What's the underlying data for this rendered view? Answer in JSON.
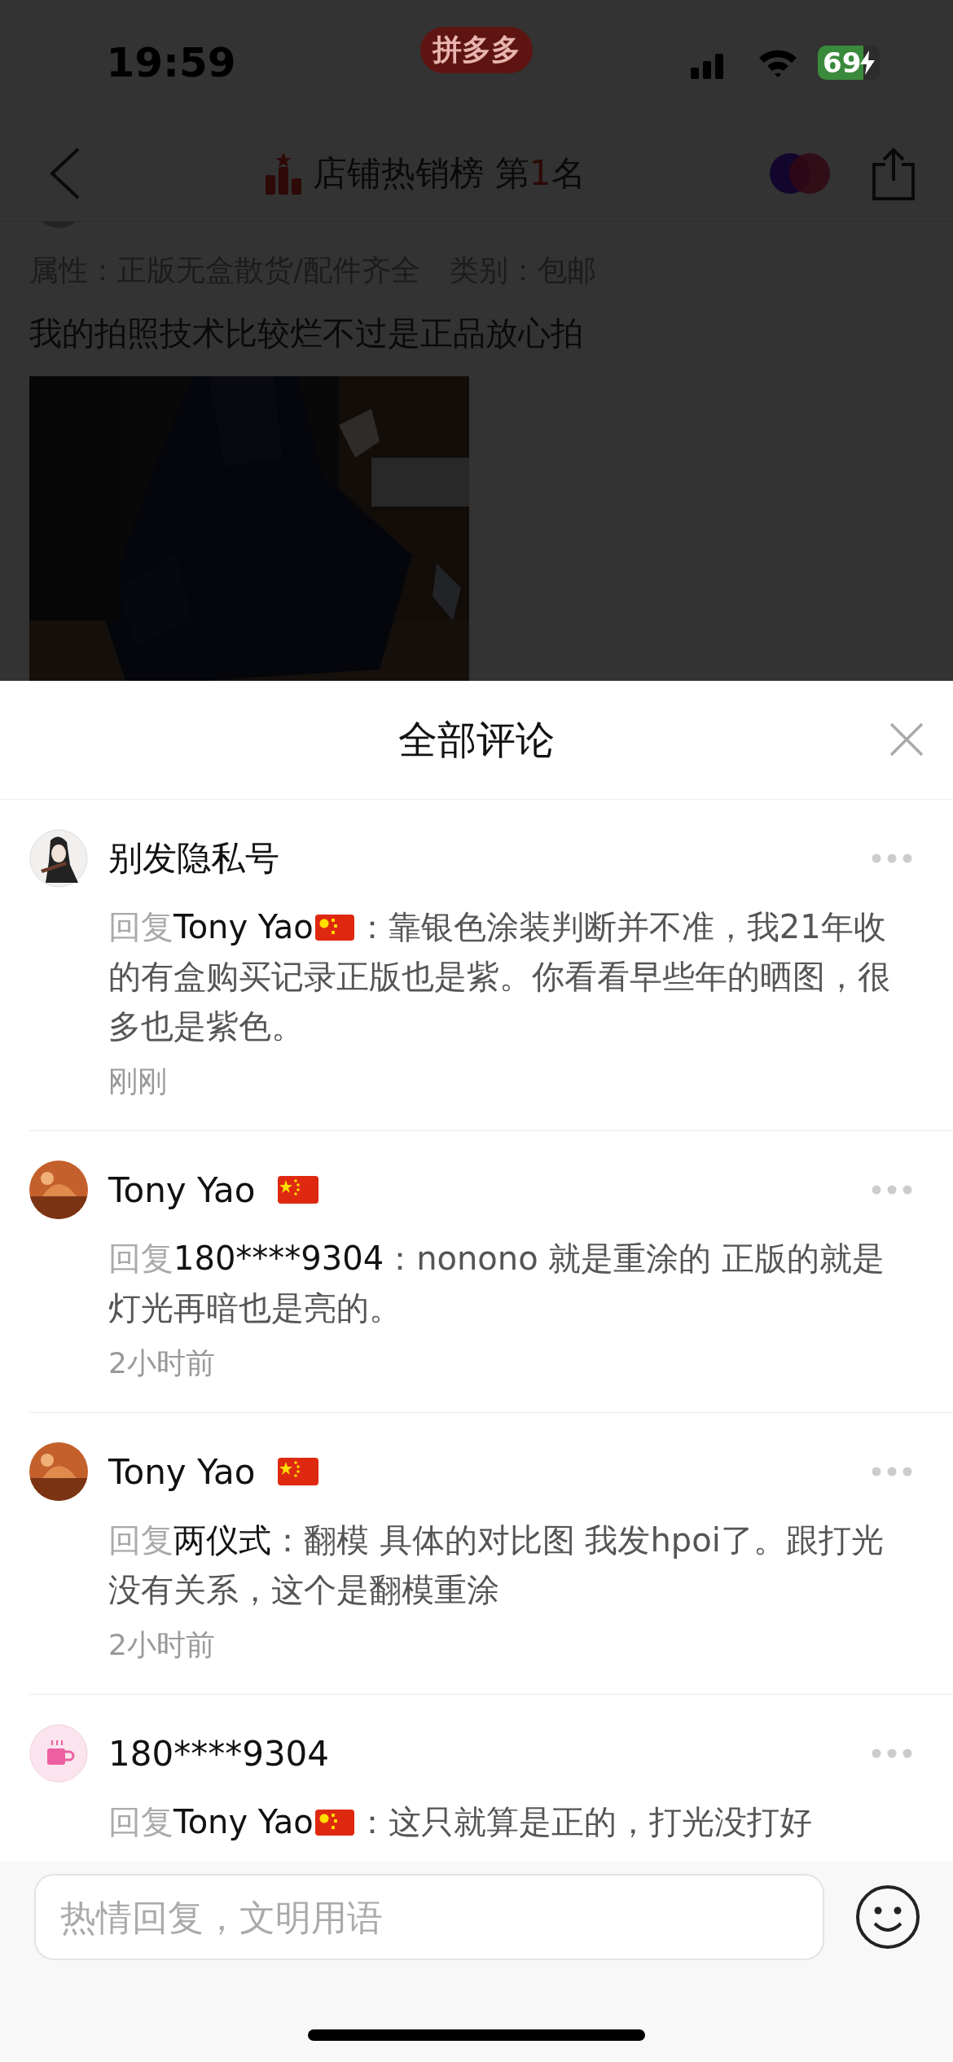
{
  "status_bar": {
    "time": "19:59",
    "app_badge": "拼多多",
    "battery": "69",
    "charging": true
  },
  "nav": {
    "title_before": "店铺热销榜 第",
    "rank": "1",
    "title_after": "名"
  },
  "product": {
    "attributes": "属性：正版无盒散货/配件齐全",
    "category": "类别：包邮",
    "description": "我的拍照技术比较烂不过是正品放心拍"
  },
  "sheet": {
    "title": "全部评论",
    "comments": [
      {
        "author": "别发隐私号",
        "author_flag": false,
        "avatar": {
          "kind": "figure"
        },
        "reply_label": "回复",
        "reply_to": "Tony Yao",
        "reply_to_flag": true,
        "text": "：靠银色涂装判断并不准，我21年收的有盒购买记录正版也是紫。你看看早些年的晒图，很多也是紫色。",
        "time": "刚刚"
      },
      {
        "author": "Tony Yao",
        "author_flag": true,
        "reply_label": "回复",
        "reply_to": "180****9304",
        "reply_to_flag": false,
        "text": "：nonono 就是重涂的 正版的就是灯光再暗也是亮的。",
        "time": "2小时前"
      },
      {
        "author": "Tony Yao",
        "author_flag": true,
        "reply_label": "回复",
        "reply_to": "两仪式",
        "reply_to_flag": false,
        "text": "：翻模 具体的对比图 我发hpoi了。跟打光没有关系，这个是翻模重涂",
        "time": "2小时前"
      },
      {
        "author": "180****9304",
        "author_flag": false,
        "avatar": {
          "kind": "cup"
        },
        "reply_label": "回复",
        "reply_to": "Tony Yao",
        "reply_to_flag": true,
        "text": "：这只就算是正的，打光没打好"
      }
    ]
  },
  "reply_bar": {
    "placeholder": "热情回复，文明用语"
  }
}
